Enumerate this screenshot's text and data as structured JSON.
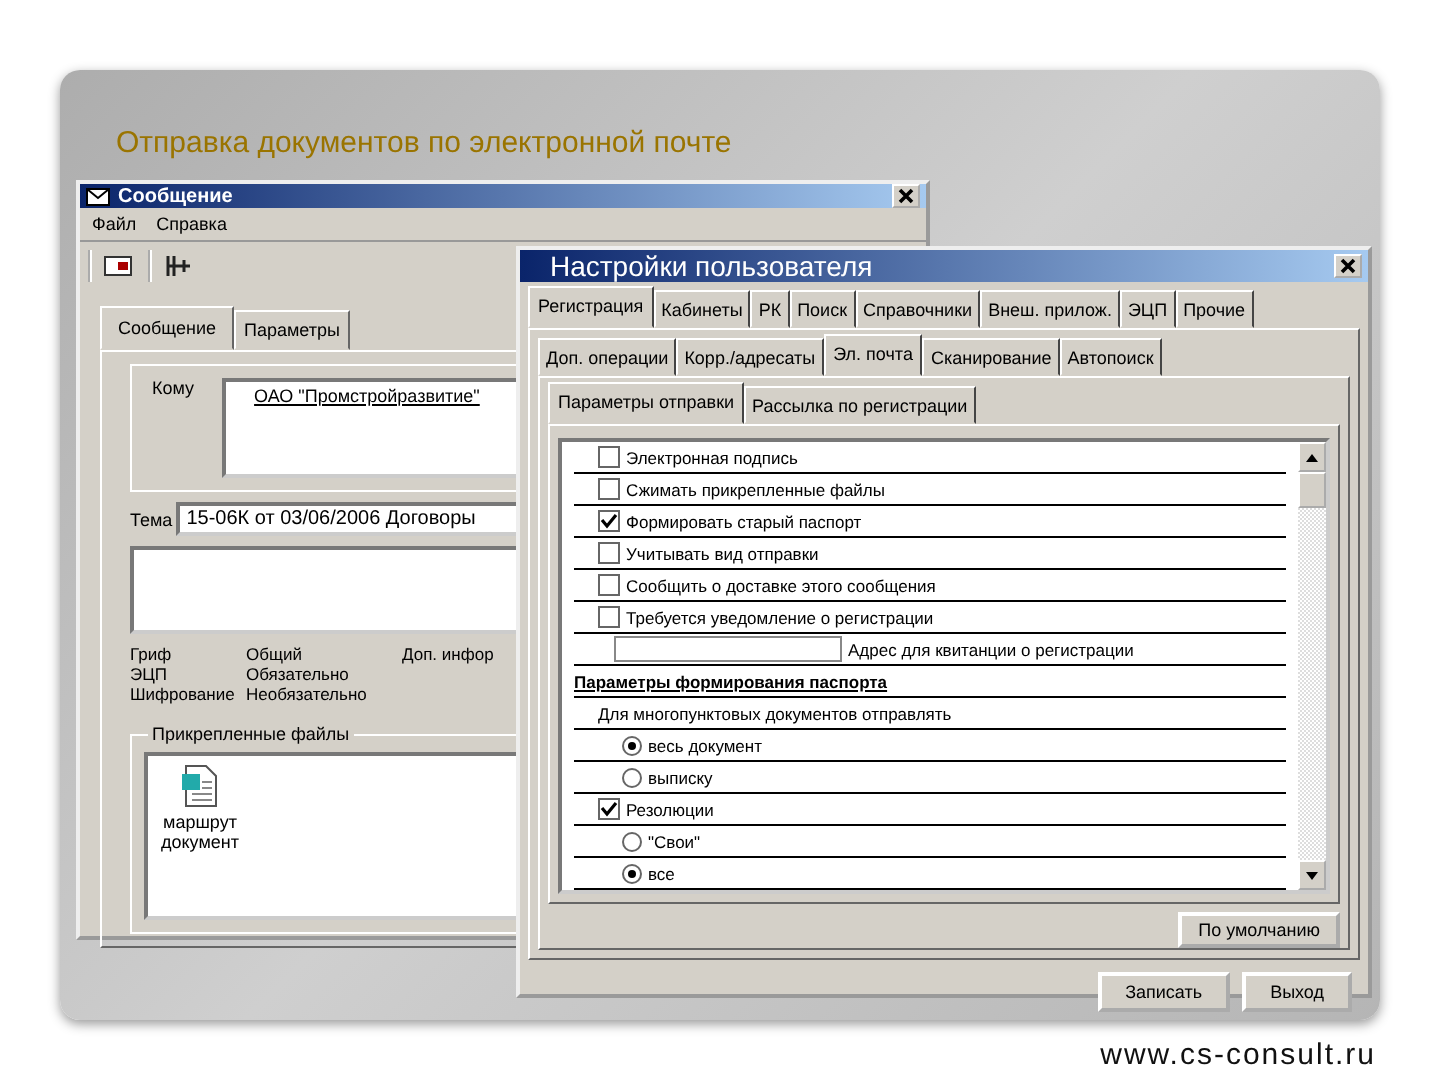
{
  "slide_title": "Отправка документов по электронной почте",
  "message_window": {
    "title": "Сообщение",
    "menu": [
      "Файл",
      "Справка"
    ],
    "tabs": [
      {
        "label": "Сообщение",
        "selected": true
      },
      {
        "label": "Параметры",
        "selected": false
      }
    ],
    "to_label": "Кому",
    "to_value": "ОАО \"Промстройразвитие\"",
    "subject_label": "Тема",
    "subject_value": "15-06К от 03/06/2006 Договоры",
    "info": [
      {
        "label": "Гриф",
        "value": "Общий"
      },
      {
        "label": "ЭЦП",
        "value": "Обязательно"
      },
      {
        "label": "Шифрование",
        "value": "Необязательно"
      }
    ],
    "extra_label": "Доп. инфор",
    "attachments_label": "Прикрепленные файлы",
    "attachments": [
      {
        "name": "маршрут документ"
      }
    ]
  },
  "settings_window": {
    "title": "Настройки пользователя",
    "tabs": [
      {
        "label": "Регистрация",
        "selected": true
      },
      {
        "label": "Кабинеты",
        "selected": false
      },
      {
        "label": "РК",
        "selected": false
      },
      {
        "label": "Поиск",
        "selected": false
      },
      {
        "label": "Справочники",
        "selected": false
      },
      {
        "label": "Внеш. прилож.",
        "selected": false
      },
      {
        "label": "ЭЦП",
        "selected": false
      },
      {
        "label": "Прочие",
        "selected": false
      }
    ],
    "subtabs": [
      {
        "label": "Доп. операции",
        "selected": false
      },
      {
        "label": "Корр./адресаты",
        "selected": false
      },
      {
        "label": "Эл. почта",
        "selected": true
      },
      {
        "label": "Сканирование",
        "selected": false
      },
      {
        "label": "Автопоиск",
        "selected": false
      }
    ],
    "inner_tabs": [
      {
        "label": "Параметры отправки",
        "selected": true
      },
      {
        "label": "Рассылка по регистрации",
        "selected": false
      }
    ],
    "rows": [
      {
        "kind": "checkbox",
        "label": "Электронная подпись",
        "checked": false
      },
      {
        "kind": "checkbox",
        "label": "Сжимать прикрепленные файлы",
        "checked": false
      },
      {
        "kind": "checkbox",
        "label": "Формировать старый паспорт",
        "checked": true
      },
      {
        "kind": "checkbox",
        "label": "Учитывать вид отправки",
        "checked": false
      },
      {
        "kind": "checkbox",
        "label": "Сообщить о доставке этого сообщения",
        "checked": false
      },
      {
        "kind": "checkbox",
        "label": "Требуется уведомление о регистрации",
        "checked": false
      },
      {
        "kind": "field",
        "label": "Адрес для квитанции о регистрации"
      },
      {
        "kind": "heading",
        "label": "Параметры формирования паспорта"
      },
      {
        "kind": "text",
        "label": "Для многопунктовых документов отправлять"
      },
      {
        "kind": "radio",
        "label": "весь документ",
        "checked": true
      },
      {
        "kind": "radio",
        "label": "выписку",
        "checked": false
      },
      {
        "kind": "checkbox",
        "label": "Резолюции",
        "checked": true
      },
      {
        "kind": "radio",
        "label": "\"Свои\"",
        "checked": false
      },
      {
        "kind": "radio",
        "label": "все",
        "checked": true
      }
    ],
    "default_button": "По умолчанию",
    "buttons": [
      "Записать",
      "Выход"
    ]
  },
  "footer": "www.cs-consult.ru"
}
